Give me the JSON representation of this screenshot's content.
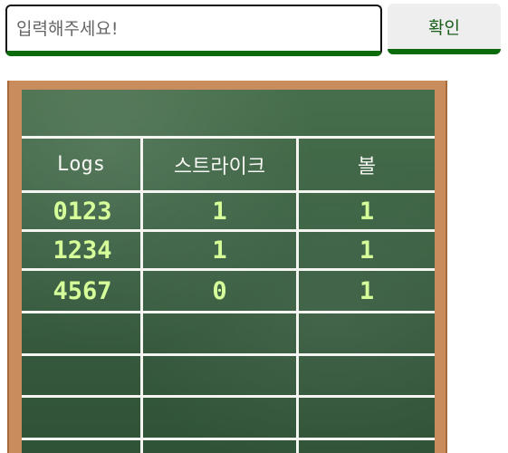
{
  "input": {
    "placeholder": "입력해주세요!",
    "value": ""
  },
  "confirm_button": {
    "label": "확인"
  },
  "board": {
    "headers": [
      "Logs",
      "스트라이크",
      "볼"
    ],
    "rows": [
      {
        "log": "0123",
        "strike": "1",
        "ball": "1"
      },
      {
        "log": "1234",
        "strike": "1",
        "ball": "1"
      },
      {
        "log": "4567",
        "strike": "0",
        "ball": "1"
      }
    ]
  },
  "colors": {
    "accent": "#0b6b0b",
    "chalk_text": "#d6ff9a",
    "board": "#3c6244",
    "frame": "#c98c5c"
  }
}
